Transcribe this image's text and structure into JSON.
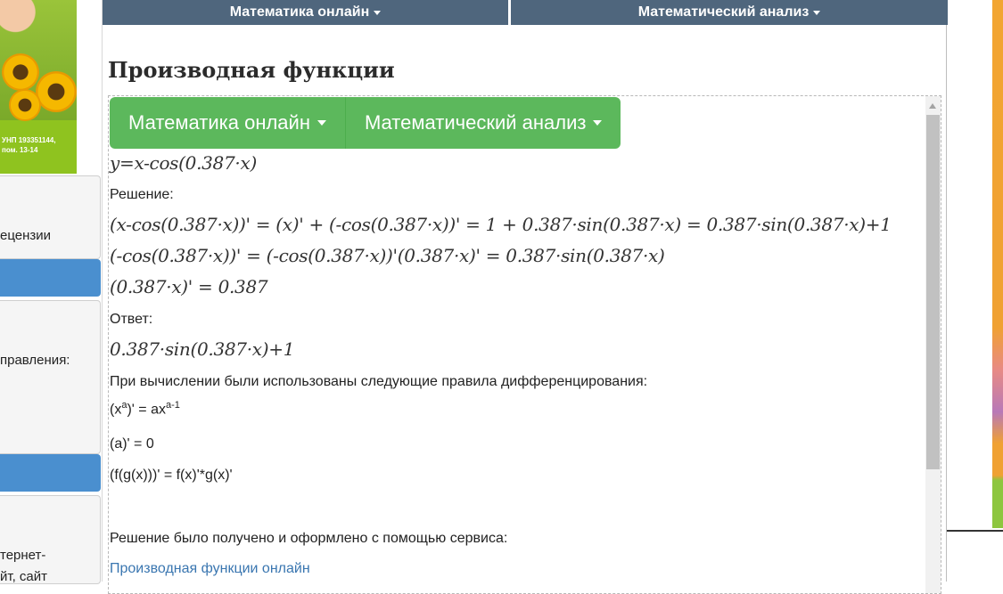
{
  "sidebar": {
    "ad_caption_line1": "УНП 193351144,",
    "ad_caption_line2": "пом. 13-14",
    "text_reviews": "ецензии",
    "text_directions": "правления:",
    "text_internet_line1": "тернет-",
    "text_internet_line2": "йт, сайт"
  },
  "top_nav": {
    "item1": "Математика онлайн",
    "item2": "Математический анализ"
  },
  "page": {
    "title": "Производная функции"
  },
  "frame": {
    "menu_btn1": "Математика онлайн",
    "menu_btn2": "Математический анализ",
    "function": "y=x-cos(0.387·x)",
    "solution_label": "Решение:",
    "step1": "(x-cos(0.387·x))' = (x)' + (-cos(0.387·x))' = 1 + 0.387·sin(0.387·x) = 0.387·sin(0.387·x)+1",
    "step2": "(-cos(0.387·x))' = (-cos(0.387·x))'(0.387·x)' = 0.387·sin(0.387·x)",
    "step3": "(0.387·x)' = 0.387",
    "answer_label": "Ответ:",
    "answer": "0.387·sin(0.387·x)+1",
    "rules_intro": "При вычислении были использованы следующие правила дифференцирования:",
    "rule1_base": "(x",
    "rule1_exp": "a",
    "rule1_mid": ")' = ax",
    "rule1_exp2": "a-1",
    "rule2": "(a)' = 0",
    "rule3": "(f(g(x)))' = f(x)'*g(x)'",
    "service_text": "Решение было получено и оформлено с помощью сервиса:",
    "service_link": "Производная функции онлайн"
  },
  "colors": {
    "nav_bg": "#4f667d",
    "green_menu": "#5cb85c",
    "sidebar_blue": "#4a8fcf",
    "link": "#3a76b0"
  }
}
